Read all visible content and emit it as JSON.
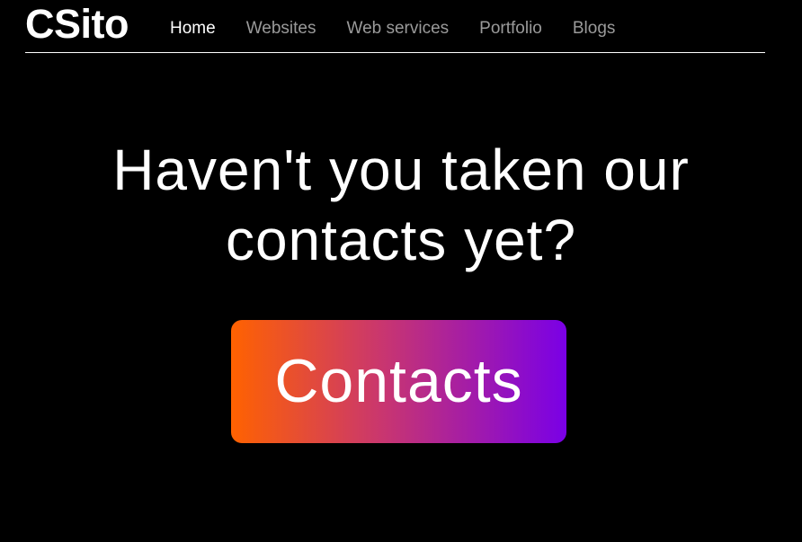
{
  "header": {
    "logo_text": "CSito",
    "nav": [
      {
        "label": "Home",
        "active": true
      },
      {
        "label": "Websites",
        "active": false
      },
      {
        "label": "Web services",
        "active": false
      },
      {
        "label": "Portfolio",
        "active": false
      },
      {
        "label": "Blogs",
        "active": false
      }
    ]
  },
  "hero": {
    "headline_line1": "Haven't you taken our",
    "headline_line2": "contacts yet?",
    "cta_label": "Contacts"
  },
  "colors": {
    "background": "#000000",
    "text": "#ffffff",
    "nav_inactive": "#9a9a9a",
    "cta_gradient_start": "#ff6200",
    "cta_gradient_end": "#7a00e6"
  }
}
